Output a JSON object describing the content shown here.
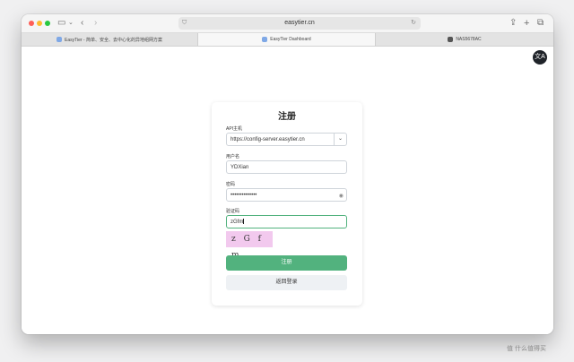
{
  "browser": {
    "url": "easytier.cn",
    "tabs": [
      {
        "label": "EasyTier - 简单、安全、去中心化的异地组网方案",
        "active": false
      },
      {
        "label": "EasyTier Dashboard",
        "active": true
      },
      {
        "label": "NAS5678AC",
        "active": false
      }
    ],
    "traffic_light_colors": [
      "#fe5f57",
      "#febc2e",
      "#28c840"
    ]
  },
  "translate_button": {
    "label": "文A"
  },
  "register_form": {
    "title": "注册",
    "api_host": {
      "label": "API主机",
      "value": "https://config-server.easytier.cn"
    },
    "username": {
      "label": "用户名",
      "value": "YDXian"
    },
    "password": {
      "label": "密码",
      "value": "••••••••••••••"
    },
    "captcha": {
      "label": "验证码",
      "value": "zGfm",
      "image_text": "z G f m"
    },
    "submit_label": "注册",
    "back_label": "返回登录"
  },
  "colors": {
    "accent": "#52b27e",
    "captcha_bg": "#f2c9ee"
  },
  "watermark": {
    "text": "值 什么值得买"
  }
}
